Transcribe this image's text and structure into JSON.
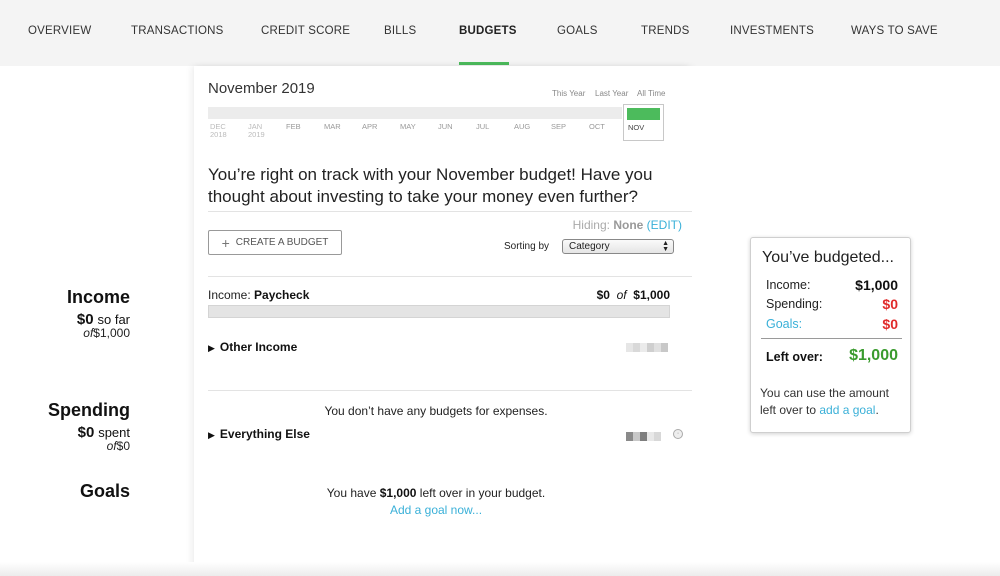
{
  "nav": {
    "items": [
      {
        "label": "OVERVIEW"
      },
      {
        "label": "TRANSACTIONS"
      },
      {
        "label": "CREDIT SCORE"
      },
      {
        "label": "BILLS"
      },
      {
        "label": "BUDGETS",
        "active": true
      },
      {
        "label": "GOALS"
      },
      {
        "label": "TRENDS"
      },
      {
        "label": "INVESTMENTS"
      },
      {
        "label": "WAYS TO SAVE"
      }
    ]
  },
  "sidebar": {
    "income": {
      "title": "Income",
      "amount": "$0",
      "suffix": "so far",
      "of": "of",
      "total": "$1,000"
    },
    "spending": {
      "title": "Spending",
      "amount": "$0",
      "suffix": "spent",
      "of": "of",
      "total": "$0"
    },
    "goals": {
      "title": "Goals"
    }
  },
  "header": {
    "month": "November 2019",
    "ranges": [
      "This Year",
      "Last Year",
      "All Time"
    ],
    "timeline": [
      {
        "month": "DEC",
        "year": "2018"
      },
      {
        "month": "JAN",
        "year": "2019"
      },
      {
        "month": "FEB"
      },
      {
        "month": "MAR"
      },
      {
        "month": "APR"
      },
      {
        "month": "MAY"
      },
      {
        "month": "JUN"
      },
      {
        "month": "JUL"
      },
      {
        "month": "AUG"
      },
      {
        "month": "SEP"
      },
      {
        "month": "OCT"
      },
      {
        "month": "NOV",
        "selected": true
      }
    ]
  },
  "message": "You’re right on track with your November budget! Have you thought about investing to take your money even further?",
  "controls": {
    "hiding_label": "Hiding:",
    "hiding_value": "None",
    "edit_label": "(EDIT)",
    "create_label": "CREATE A BUDGET",
    "sort_label": "Sorting by",
    "sort_value": "Category"
  },
  "income_section": {
    "label_prefix": "Income:",
    "label_name": "Paycheck",
    "spent": "$0",
    "of": "of",
    "budget": "$1,000",
    "progress": 0,
    "other_income": "Other Income"
  },
  "spending_section": {
    "empty_message": "You don’t have any budgets for expenses.",
    "everything_else": "Everything Else"
  },
  "goals_section": {
    "prefix": "You have",
    "amount": "$1,000",
    "suffix": "left over in your budget.",
    "link": "Add a goal now..."
  },
  "card": {
    "title": "You’ve budgeted...",
    "income_label": "Income:",
    "income_value": "$1,000",
    "spending_label": "Spending:",
    "spending_value": "$0",
    "goals_label": "Goals:",
    "goals_value": "$0",
    "leftover_label": "Left over:",
    "leftover_value": "$1,000",
    "note_text": "You can use the amount left over to",
    "note_link": "add a goal",
    "note_end": "."
  },
  "colors": {
    "accent_green": "#4cbb5c",
    "link_blue": "#3ab0d8",
    "negative_red": "#e02b2b",
    "positive_green": "#3a9b2e"
  }
}
